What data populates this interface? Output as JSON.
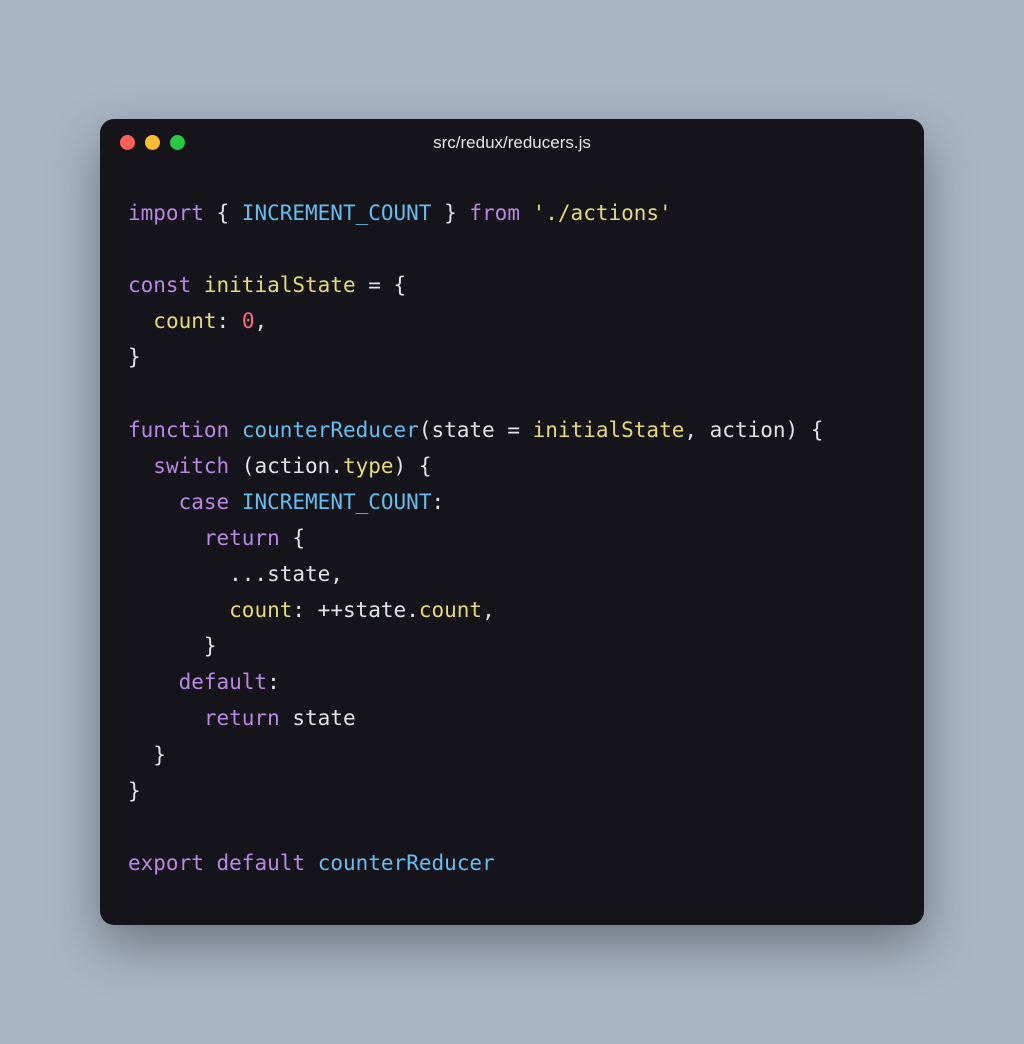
{
  "window": {
    "filename": "src/redux/reducers.js",
    "traffic_lights": {
      "close": "#ff5f57",
      "minimize": "#febc2e",
      "zoom": "#28c840"
    }
  },
  "code": {
    "lines": [
      [
        {
          "t": "import",
          "c": "kw"
        },
        {
          "t": " { ",
          "c": "punct"
        },
        {
          "t": "INCREMENT_COUNT",
          "c": "ident"
        },
        {
          "t": " } ",
          "c": "punct"
        },
        {
          "t": "from",
          "c": "kw"
        },
        {
          "t": " ",
          "c": "punct"
        },
        {
          "t": "'./actions'",
          "c": "str"
        }
      ],
      [],
      [
        {
          "t": "const",
          "c": "kw"
        },
        {
          "t": " ",
          "c": "punct"
        },
        {
          "t": "initialState",
          "c": "var"
        },
        {
          "t": " = {",
          "c": "punct"
        }
      ],
      [
        {
          "t": "  ",
          "c": "punct"
        },
        {
          "t": "count",
          "c": "prop"
        },
        {
          "t": ": ",
          "c": "punct"
        },
        {
          "t": "0",
          "c": "num"
        },
        {
          "t": ",",
          "c": "punct"
        }
      ],
      [
        {
          "t": "}",
          "c": "punct"
        }
      ],
      [],
      [
        {
          "t": "function",
          "c": "kw"
        },
        {
          "t": " ",
          "c": "punct"
        },
        {
          "t": "counterReducer",
          "c": "fn"
        },
        {
          "t": "(",
          "c": "punct"
        },
        {
          "t": "state",
          "c": "param"
        },
        {
          "t": " = ",
          "c": "punct"
        },
        {
          "t": "initialState",
          "c": "var"
        },
        {
          "t": ", ",
          "c": "punct"
        },
        {
          "t": "action",
          "c": "param"
        },
        {
          "t": ") {",
          "c": "punct"
        }
      ],
      [
        {
          "t": "  ",
          "c": "punct"
        },
        {
          "t": "switch",
          "c": "kw"
        },
        {
          "t": " (",
          "c": "punct"
        },
        {
          "t": "action",
          "c": "param"
        },
        {
          "t": ".",
          "c": "punct"
        },
        {
          "t": "type",
          "c": "prop"
        },
        {
          "t": ") {",
          "c": "punct"
        }
      ],
      [
        {
          "t": "    ",
          "c": "punct"
        },
        {
          "t": "case",
          "c": "kw"
        },
        {
          "t": " ",
          "c": "punct"
        },
        {
          "t": "INCREMENT_COUNT",
          "c": "ident"
        },
        {
          "t": ":",
          "c": "punct"
        }
      ],
      [
        {
          "t": "      ",
          "c": "punct"
        },
        {
          "t": "return",
          "c": "kw"
        },
        {
          "t": " {",
          "c": "punct"
        }
      ],
      [
        {
          "t": "        ...",
          "c": "punct"
        },
        {
          "t": "state",
          "c": "param"
        },
        {
          "t": ",",
          "c": "punct"
        }
      ],
      [
        {
          "t": "        ",
          "c": "punct"
        },
        {
          "t": "count",
          "c": "prop"
        },
        {
          "t": ": ",
          "c": "punct"
        },
        {
          "t": "++",
          "c": "op"
        },
        {
          "t": "state",
          "c": "param"
        },
        {
          "t": ".",
          "c": "punct"
        },
        {
          "t": "count",
          "c": "prop"
        },
        {
          "t": ",",
          "c": "punct"
        }
      ],
      [
        {
          "t": "      }",
          "c": "punct"
        }
      ],
      [
        {
          "t": "    ",
          "c": "punct"
        },
        {
          "t": "default",
          "c": "kw"
        },
        {
          "t": ":",
          "c": "punct"
        }
      ],
      [
        {
          "t": "      ",
          "c": "punct"
        },
        {
          "t": "return",
          "c": "kw"
        },
        {
          "t": " ",
          "c": "punct"
        },
        {
          "t": "state",
          "c": "param"
        }
      ],
      [
        {
          "t": "  }",
          "c": "punct"
        }
      ],
      [
        {
          "t": "}",
          "c": "punct"
        }
      ],
      [],
      [
        {
          "t": "export",
          "c": "kw"
        },
        {
          "t": " ",
          "c": "punct"
        },
        {
          "t": "default",
          "c": "kw"
        },
        {
          "t": " ",
          "c": "punct"
        },
        {
          "t": "counterReducer",
          "c": "fn"
        }
      ]
    ]
  }
}
